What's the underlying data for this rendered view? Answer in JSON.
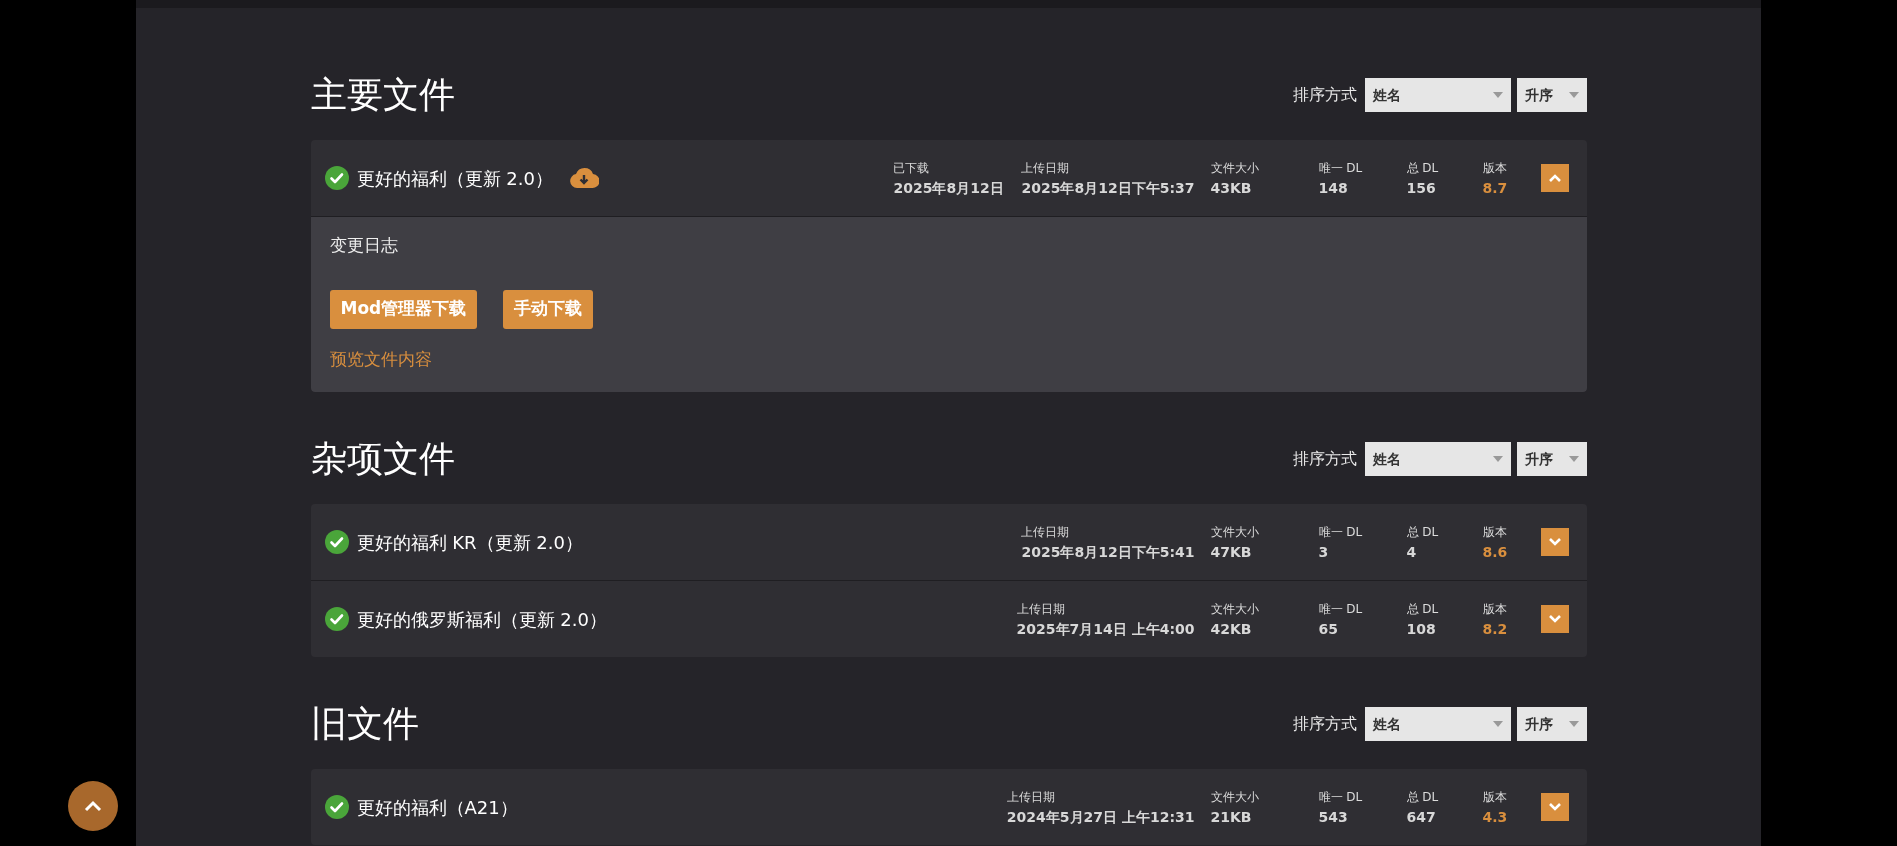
{
  "sections": [
    {
      "title": "主要文件",
      "sort": {
        "label": "排序方式",
        "field": "姓名",
        "order": "升序"
      },
      "files": [
        {
          "name": "更好的福利（更新 2.0）",
          "verified": true,
          "downloaded_icon": true,
          "expanded": true,
          "stats": [
            {
              "label": "已下载",
              "value": "2025年8月12日",
              "kind": "plain"
            },
            {
              "label": "上传日期",
              "value": "2025年8月12日下午5:37",
              "kind": "plain"
            },
            {
              "label": "文件大小",
              "value": "43KB",
              "kind": "plain"
            },
            {
              "label": "唯一 DL",
              "value": "148",
              "kind": "plain"
            },
            {
              "label": "总 DL",
              "value": "156",
              "kind": "plain"
            },
            {
              "label": "版本",
              "value": "8.7",
              "kind": "version"
            }
          ],
          "details": {
            "changelog": "变更日志",
            "buttons": [
              "Mod管理器下载",
              "手动下载"
            ],
            "preview_link": "预览文件内容"
          }
        }
      ]
    },
    {
      "title": "杂项文件",
      "sort": {
        "label": "排序方式",
        "field": "姓名",
        "order": "升序"
      },
      "files": [
        {
          "name": "更好的福利 KR（更新 2.0）",
          "verified": true,
          "downloaded_icon": false,
          "expanded": false,
          "stats": [
            {
              "label": "上传日期",
              "value": "2025年8月12日下午5:41",
              "kind": "plain"
            },
            {
              "label": "文件大小",
              "value": "47KB",
              "kind": "plain"
            },
            {
              "label": "唯一 DL",
              "value": "3",
              "kind": "plain"
            },
            {
              "label": "总 DL",
              "value": "4",
              "kind": "plain"
            },
            {
              "label": "版本",
              "value": "8.6",
              "kind": "version"
            }
          ]
        },
        {
          "name": "更好的俄罗斯福利（更新 2.0）",
          "verified": true,
          "downloaded_icon": false,
          "expanded": false,
          "stats": [
            {
              "label": "上传日期",
              "value": "2025年7月14日 上午4:00",
              "kind": "plain"
            },
            {
              "label": "文件大小",
              "value": "42KB",
              "kind": "plain"
            },
            {
              "label": "唯一 DL",
              "value": "65",
              "kind": "plain"
            },
            {
              "label": "总 DL",
              "value": "108",
              "kind": "plain"
            },
            {
              "label": "版本",
              "value": "8.2",
              "kind": "version"
            }
          ]
        }
      ]
    },
    {
      "title": "旧文件",
      "sort": {
        "label": "排序方式",
        "field": "姓名",
        "order": "升序"
      },
      "files": [
        {
          "name": "更好的福利（A21）",
          "verified": true,
          "downloaded_icon": false,
          "expanded": false,
          "stats": [
            {
              "label": "上传日期",
              "value": "2024年5月27日 上午12:31",
              "kind": "plain"
            },
            {
              "label": "文件大小",
              "value": "21KB",
              "kind": "plain"
            },
            {
              "label": "唯一 DL",
              "value": "543",
              "kind": "plain"
            },
            {
              "label": "总 DL",
              "value": "647",
              "kind": "plain"
            },
            {
              "label": "版本",
              "value": "4.3",
              "kind": "version"
            }
          ]
        }
      ]
    }
  ]
}
